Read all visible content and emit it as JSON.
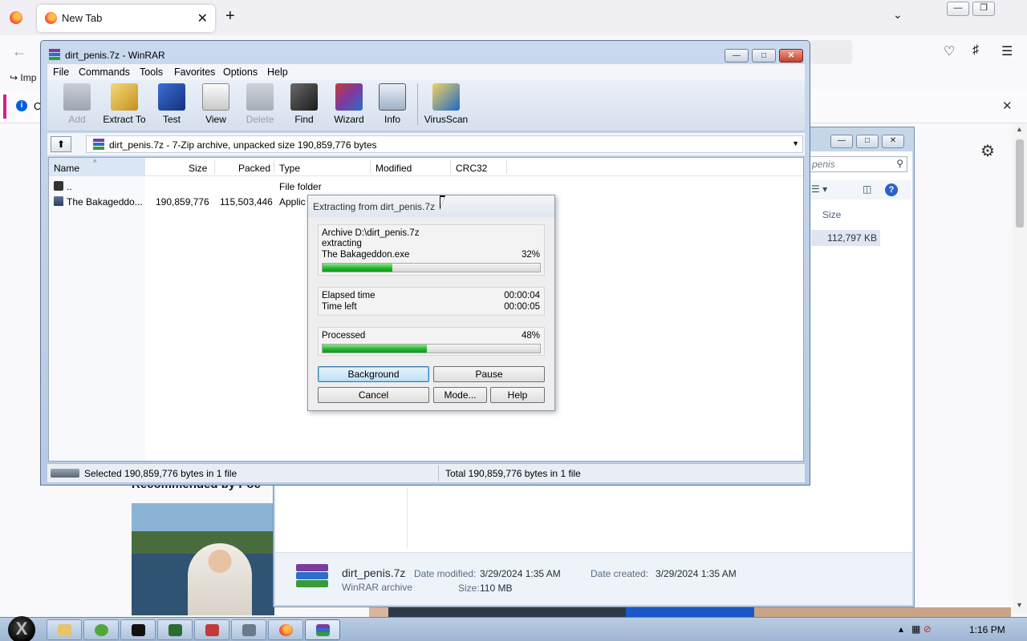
{
  "browser": {
    "tab_title": "New Tab",
    "tab_close": "✕",
    "new_tab": "+",
    "import_label": "Imp",
    "notification_text": "C",
    "recommended_heading": "Recommended by Poc"
  },
  "explorer": {
    "search_text": "penis",
    "size_header": "Size",
    "size_value": "112,797 KB",
    "details": {
      "file_name": "dirt_penis.7z",
      "file_type": "WinRAR archive",
      "date_modified_label": "Date modified:",
      "date_modified": "3/29/2024 1:35 AM",
      "size_label": "Size:",
      "size": "110 MB",
      "date_created_label": "Date created:",
      "date_created": "3/29/2024 1:35 AM"
    }
  },
  "winrar": {
    "title": "dirt_penis.7z - WinRAR",
    "menu": [
      "File",
      "Commands",
      "Tools",
      "Favorites",
      "Options",
      "Help"
    ],
    "toolbar": [
      {
        "label": "Add",
        "icon": "add-icon",
        "enabled": false
      },
      {
        "label": "Extract To",
        "icon": "extract-to-icon",
        "enabled": true
      },
      {
        "label": "Test",
        "icon": "test-icon",
        "enabled": true
      },
      {
        "label": "View",
        "icon": "view-icon",
        "enabled": true
      },
      {
        "label": "Delete",
        "icon": "delete-icon",
        "enabled": false
      },
      {
        "label": "Find",
        "icon": "find-icon",
        "enabled": true
      },
      {
        "label": "Wizard",
        "icon": "wizard-icon",
        "enabled": true
      },
      {
        "label": "Info",
        "icon": "info-icon",
        "enabled": true
      },
      {
        "label": "VirusScan",
        "icon": "virusscan-icon",
        "enabled": true
      }
    ],
    "path": "dirt_penis.7z - 7-Zip archive, unpacked size 190,859,776 bytes",
    "columns": [
      "Name",
      "Size",
      "Packed",
      "Type",
      "Modified",
      "CRC32"
    ],
    "rows": [
      {
        "name": "..",
        "size": "",
        "packed": "",
        "type": "File folder"
      },
      {
        "name": "The Bakageddo...",
        "size": "190,859,776",
        "packed": "115,503,446",
        "type": "Applic"
      }
    ],
    "status_left": "Selected 190,859,776 bytes in 1 file",
    "status_right": "Total 190,859,776 bytes in 1 file"
  },
  "extract_dialog": {
    "title": "Extracting from dirt_penis.7z",
    "archive_line": "Archive D:\\dirt_penis.7z",
    "action": "extracting",
    "current_file": "The Bakageddon.exe",
    "file_percent": "32%",
    "file_progress": 32,
    "elapsed_label": "Elapsed time",
    "elapsed_value": "00:00:04",
    "left_label": "Time left",
    "left_value": "00:00:05",
    "processed_label": "Processed",
    "processed_percent": "48%",
    "processed_progress": 48,
    "buttons": {
      "background": "Background",
      "pause": "Pause",
      "cancel": "Cancel",
      "mode": "Mode...",
      "help": "Help"
    }
  },
  "taskbar": {
    "clock": "1:16 PM"
  },
  "colors": {
    "progress_green": "#1fb02c",
    "winrar_frame": "#c9d9ee",
    "close_red": "#c7402a"
  }
}
